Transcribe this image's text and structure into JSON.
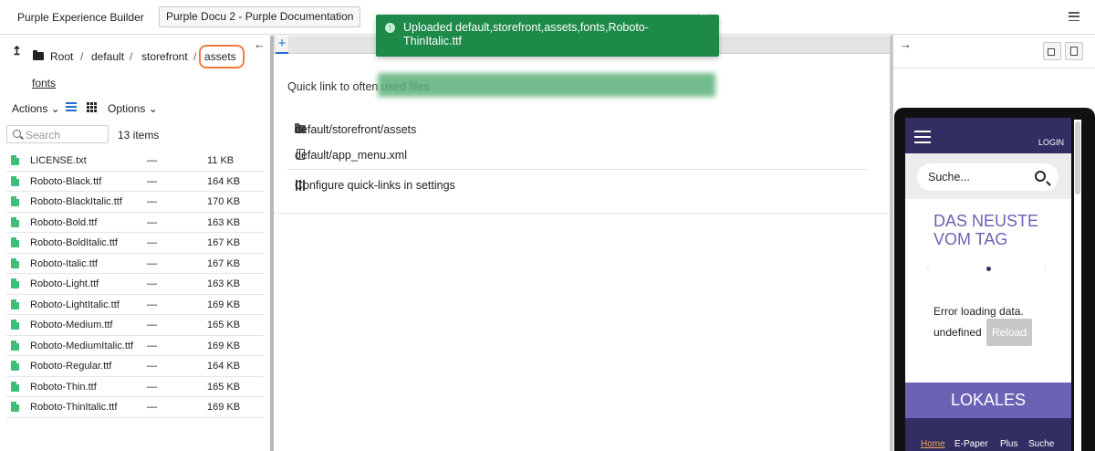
{
  "header": {
    "app_title": "Purple Experience Builder",
    "project_label": "Purple Docu 2 - Purple Documentation",
    "menu_icon": "hamburger-icon"
  },
  "toast": {
    "message": "Uploaded default,storefront,assets,fonts,Roboto-ThinItalic.ttf",
    "close": "×",
    "icon": "arrow-up-circle-icon",
    "color": "#1e8a4a"
  },
  "file_browser": {
    "up_icon": "↥",
    "breadcrumb": [
      "Root",
      "default",
      "storefront",
      "assets"
    ],
    "separator": "/",
    "current_folder": "fonts",
    "actions_label": "Actions ⌄",
    "options_label": "Options ⌄",
    "search_placeholder": "Search",
    "item_count": "13 items",
    "files": [
      {
        "name": "LICENSE.txt",
        "modified": "—",
        "size": "11 KB"
      },
      {
        "name": "Roboto-Black.ttf",
        "modified": "—",
        "size": "164 KB"
      },
      {
        "name": "Roboto-BlackItalic.ttf",
        "modified": "—",
        "size": "170 KB"
      },
      {
        "name": "Roboto-Bold.ttf",
        "modified": "—",
        "size": "163 KB"
      },
      {
        "name": "Roboto-BoldItalic.ttf",
        "modified": "—",
        "size": "167 KB"
      },
      {
        "name": "Roboto-Italic.ttf",
        "modified": "—",
        "size": "167 KB"
      },
      {
        "name": "Roboto-Light.ttf",
        "modified": "—",
        "size": "163 KB"
      },
      {
        "name": "Roboto-LightItalic.ttf",
        "modified": "—",
        "size": "169 KB"
      },
      {
        "name": "Roboto-Medium.ttf",
        "modified": "—",
        "size": "165 KB"
      },
      {
        "name": "Roboto-MediumItalic.ttf",
        "modified": "—",
        "size": "169 KB"
      },
      {
        "name": "Roboto-Regular.ttf",
        "modified": "—",
        "size": "164 KB"
      },
      {
        "name": "Roboto-Thin.ttf",
        "modified": "—",
        "size": "165 KB"
      },
      {
        "name": "Roboto-ThinItalic.ttf",
        "modified": "—",
        "size": "169 KB"
      }
    ]
  },
  "editor": {
    "collapse_left": "←",
    "add_tab": "+",
    "quick_title": "Quick link to often used files",
    "quick_links": [
      {
        "label": "default/storefront/assets",
        "icon": "folder-icon"
      },
      {
        "label": "default/app_menu.xml",
        "icon": "file-icon"
      }
    ],
    "configure_label": "Configure quick-links in settings"
  },
  "preview": {
    "expand_right": "→",
    "mobile": {
      "login": "LOGIN",
      "search_text": "Suche...",
      "headline": "DAS NEUSTE VOM TAG",
      "error_text": "Error loading data.",
      "undefined_text": "undefined",
      "reload_label": "Reload",
      "section_label": "LOKALES",
      "footer_items": [
        "Home",
        "E-Paper",
        "Plus",
        "Suche"
      ],
      "nav_color": "#322d63",
      "accent_color": "#6b62b5"
    }
  }
}
